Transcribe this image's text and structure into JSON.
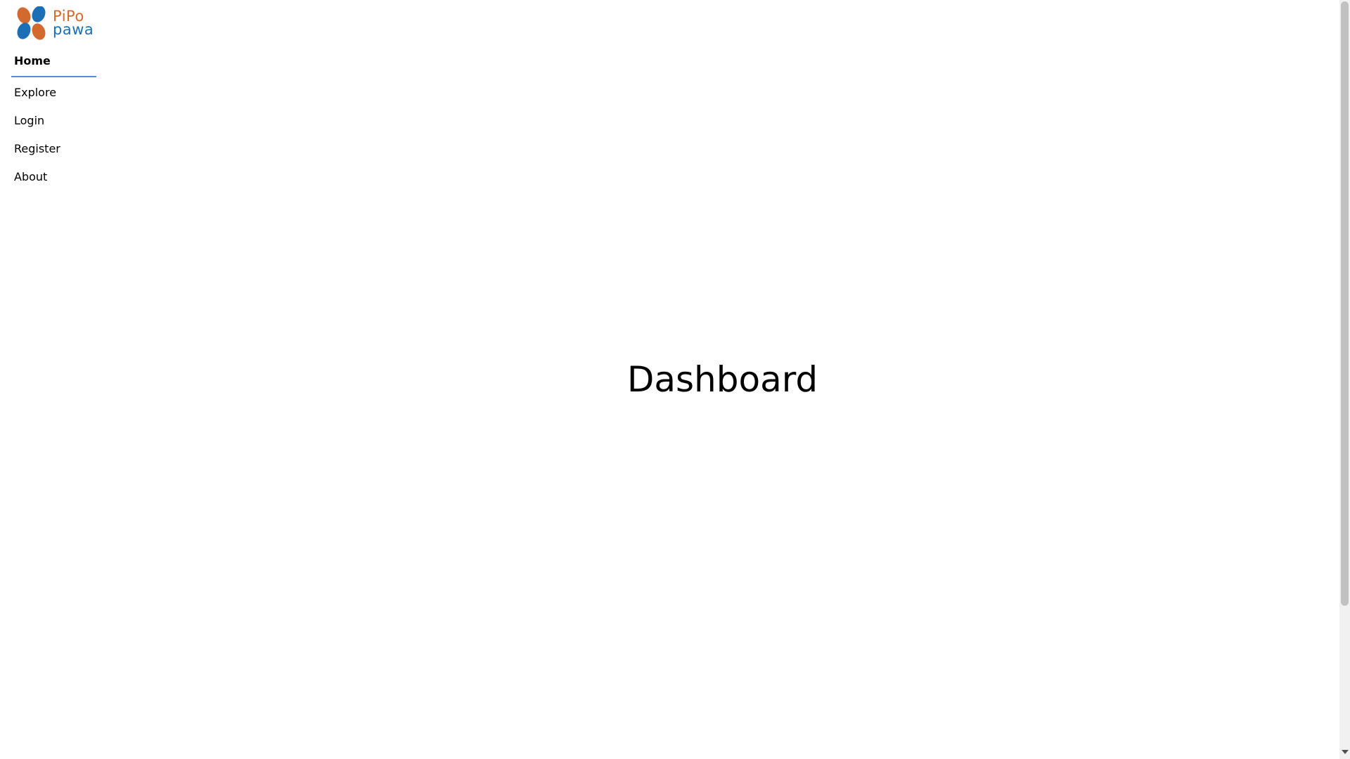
{
  "brand": {
    "line1": "PiPo",
    "line2": "pawa",
    "color_orange": "#d26a2e",
    "color_blue": "#1a6fb5"
  },
  "nav": {
    "items": [
      {
        "label": "Home",
        "active": true
      },
      {
        "label": "Explore",
        "active": false
      },
      {
        "label": "Login",
        "active": false
      },
      {
        "label": "Register",
        "active": false
      },
      {
        "label": "About",
        "active": false
      }
    ],
    "active_underline_color": "#4a8fe3"
  },
  "main": {
    "title": "Dashboard"
  },
  "icons": {
    "logo": "pipo-pawa-logo-icon",
    "scroll_down": "chevron-down-icon"
  }
}
